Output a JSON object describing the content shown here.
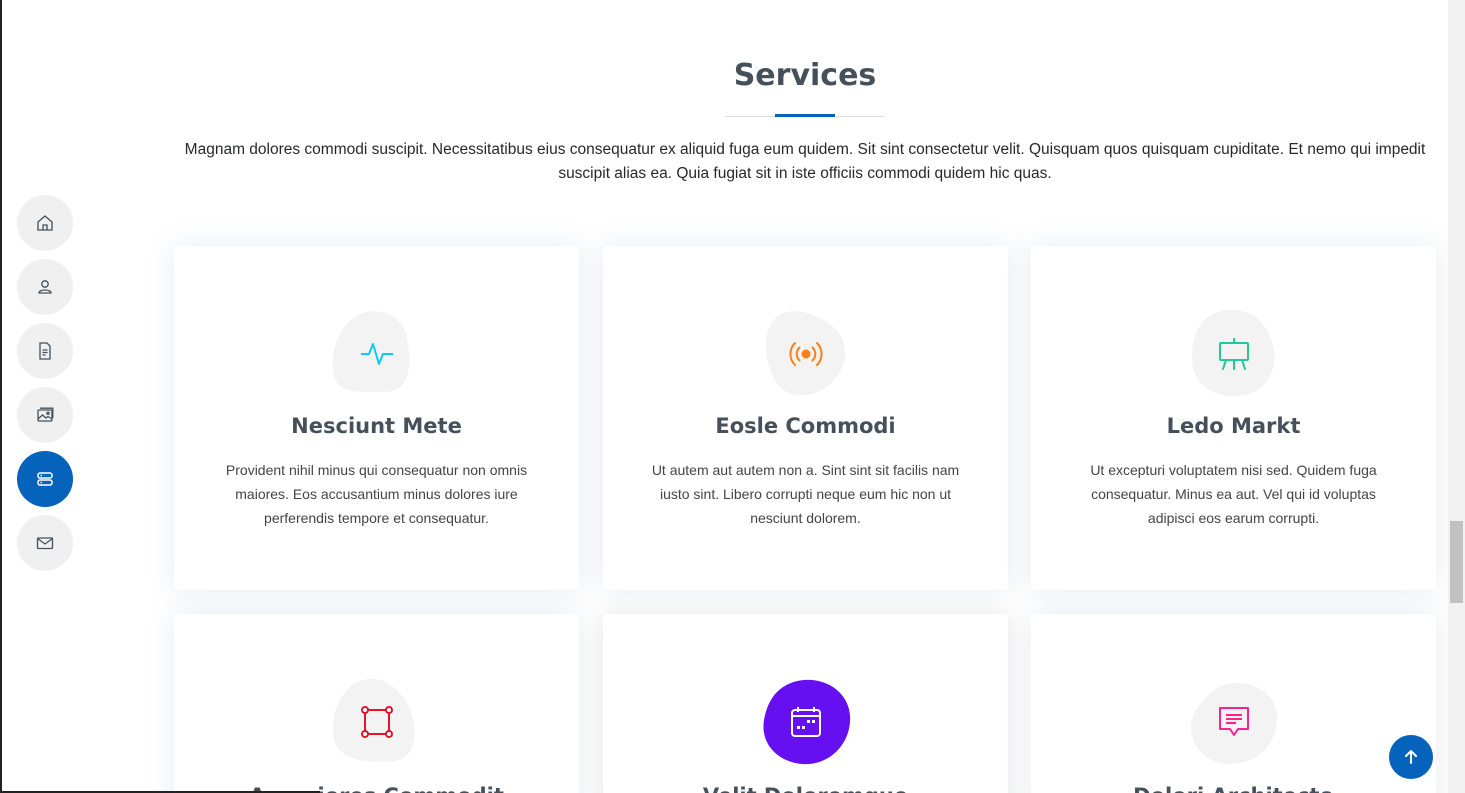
{
  "nav": {
    "items": [
      {
        "icon": "home-icon",
        "active": false
      },
      {
        "icon": "person-icon",
        "active": false
      },
      {
        "icon": "file-text-icon",
        "active": false
      },
      {
        "icon": "images-icon",
        "active": false
      },
      {
        "icon": "server-icon",
        "active": true
      },
      {
        "icon": "envelope-icon",
        "active": false
      }
    ]
  },
  "section": {
    "title": "Services",
    "description": "Magnam dolores commodi suscipit. Necessitatibus eius consequatur ex aliquid fuga eum quidem. Sit sint consectetur velit. Quisquam quos quisquam cupiditate. Et nemo qui impedit suscipit alias ea. Quia fugiat sit in iste officiis commodi quidem hic quas."
  },
  "services": [
    {
      "title": "Nesciunt Mete",
      "text": "Provident nihil minus qui consequatur non omnis maiores. Eos accusantium minus dolores iure perferendis tempore et consequatur.",
      "icon": "activity-icon",
      "color": "#0dcaf0"
    },
    {
      "title": "Eosle Commodi",
      "text": "Ut autem aut autem non a. Sint sint sit facilis nam iusto sint. Libero corrupti neque eum hic non ut nesciunt dolorem.",
      "icon": "broadcast-icon",
      "color": "#fd7e14"
    },
    {
      "title": "Ledo Markt",
      "text": "Ut excepturi voluptatem nisi sed. Quidem fuga consequatur. Minus ea aut. Vel qui id voluptas adipisci eos earum corrupti.",
      "icon": "easel-icon",
      "color": "#20c997"
    },
    {
      "title": "Asperiores Commodit",
      "text": "",
      "icon": "bounding-box-icon",
      "color": "#df1529"
    },
    {
      "title": "Velit Doloremque",
      "text": "",
      "icon": "calendar-icon",
      "color": "#6610f2"
    },
    {
      "title": "Dolori Architecto",
      "text": "",
      "icon": "chat-square-text-icon",
      "color": "#f3268c"
    }
  ],
  "colors": {
    "accent": "#0563bb",
    "heading": "#45505b"
  }
}
